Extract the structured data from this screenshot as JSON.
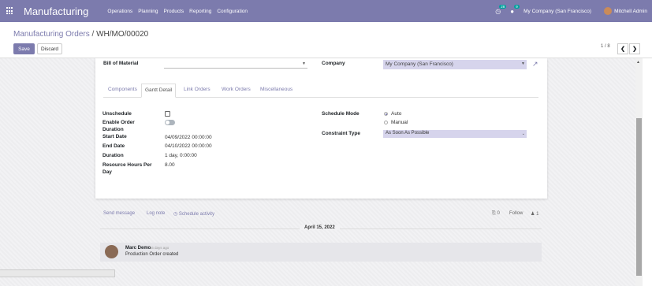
{
  "navbar": {
    "app_title": "Manufacturing",
    "menu": [
      "Operations",
      "Planning",
      "Products",
      "Reporting",
      "Configuration"
    ],
    "activity_count": "28",
    "message_count": "9",
    "company": "My Company (San Francisco)",
    "user": "Mitchell Admin"
  },
  "breadcrumb": {
    "parent": "Manufacturing Orders",
    "separator": "/",
    "current": "WH/MO/00020"
  },
  "actions": {
    "save_label": "Save",
    "discard_label": "Discard"
  },
  "pager": {
    "value": "1 / 8",
    "prev": "❮",
    "next": "❯"
  },
  "form": {
    "bom_label": "Bill of Material",
    "bom_value": "",
    "company_label": "Company",
    "company_value": "My Company (San Francisco)",
    "tabs": [
      "Components",
      "Gantt Detail",
      "Link Orders",
      "Work Orders",
      "Miscellaneous"
    ],
    "active_tab": "Gantt Detail",
    "unschedule_label": "Unschedule",
    "enable_order_duration_label_1": "Enable Order",
    "enable_order_duration_label_2": "Duration",
    "start_date_label": "Start Date",
    "start_date_value": "04/09/2022 00:00:00",
    "end_date_label": "End Date",
    "end_date_value": "04/10/2022 00:00:00",
    "duration_label": "Duration",
    "duration_value": "1 day, 0:00:00",
    "resource_hours_label_1": "Resource Hours Per",
    "resource_hours_label_2": "Day",
    "resource_hours_value": "8.00",
    "schedule_mode_label": "Schedule Mode",
    "schedule_mode_options": [
      "Auto",
      "Manual"
    ],
    "constraint_type_label": "Constraint Type",
    "constraint_type_value": "As Soon As Possible"
  },
  "chatter": {
    "send_message": "Send message",
    "log_note": "Log note",
    "schedule_activity": "Schedule activity",
    "attachments": "0",
    "follow": "Follow",
    "followers": "1",
    "date": "April 15, 2022",
    "message": {
      "author": "Marc Demo",
      "time": "- 16 days ago",
      "body": "Production Order created"
    }
  },
  "colors": {
    "brand": "#7c7bad",
    "highlight": "#d6d4ec"
  }
}
